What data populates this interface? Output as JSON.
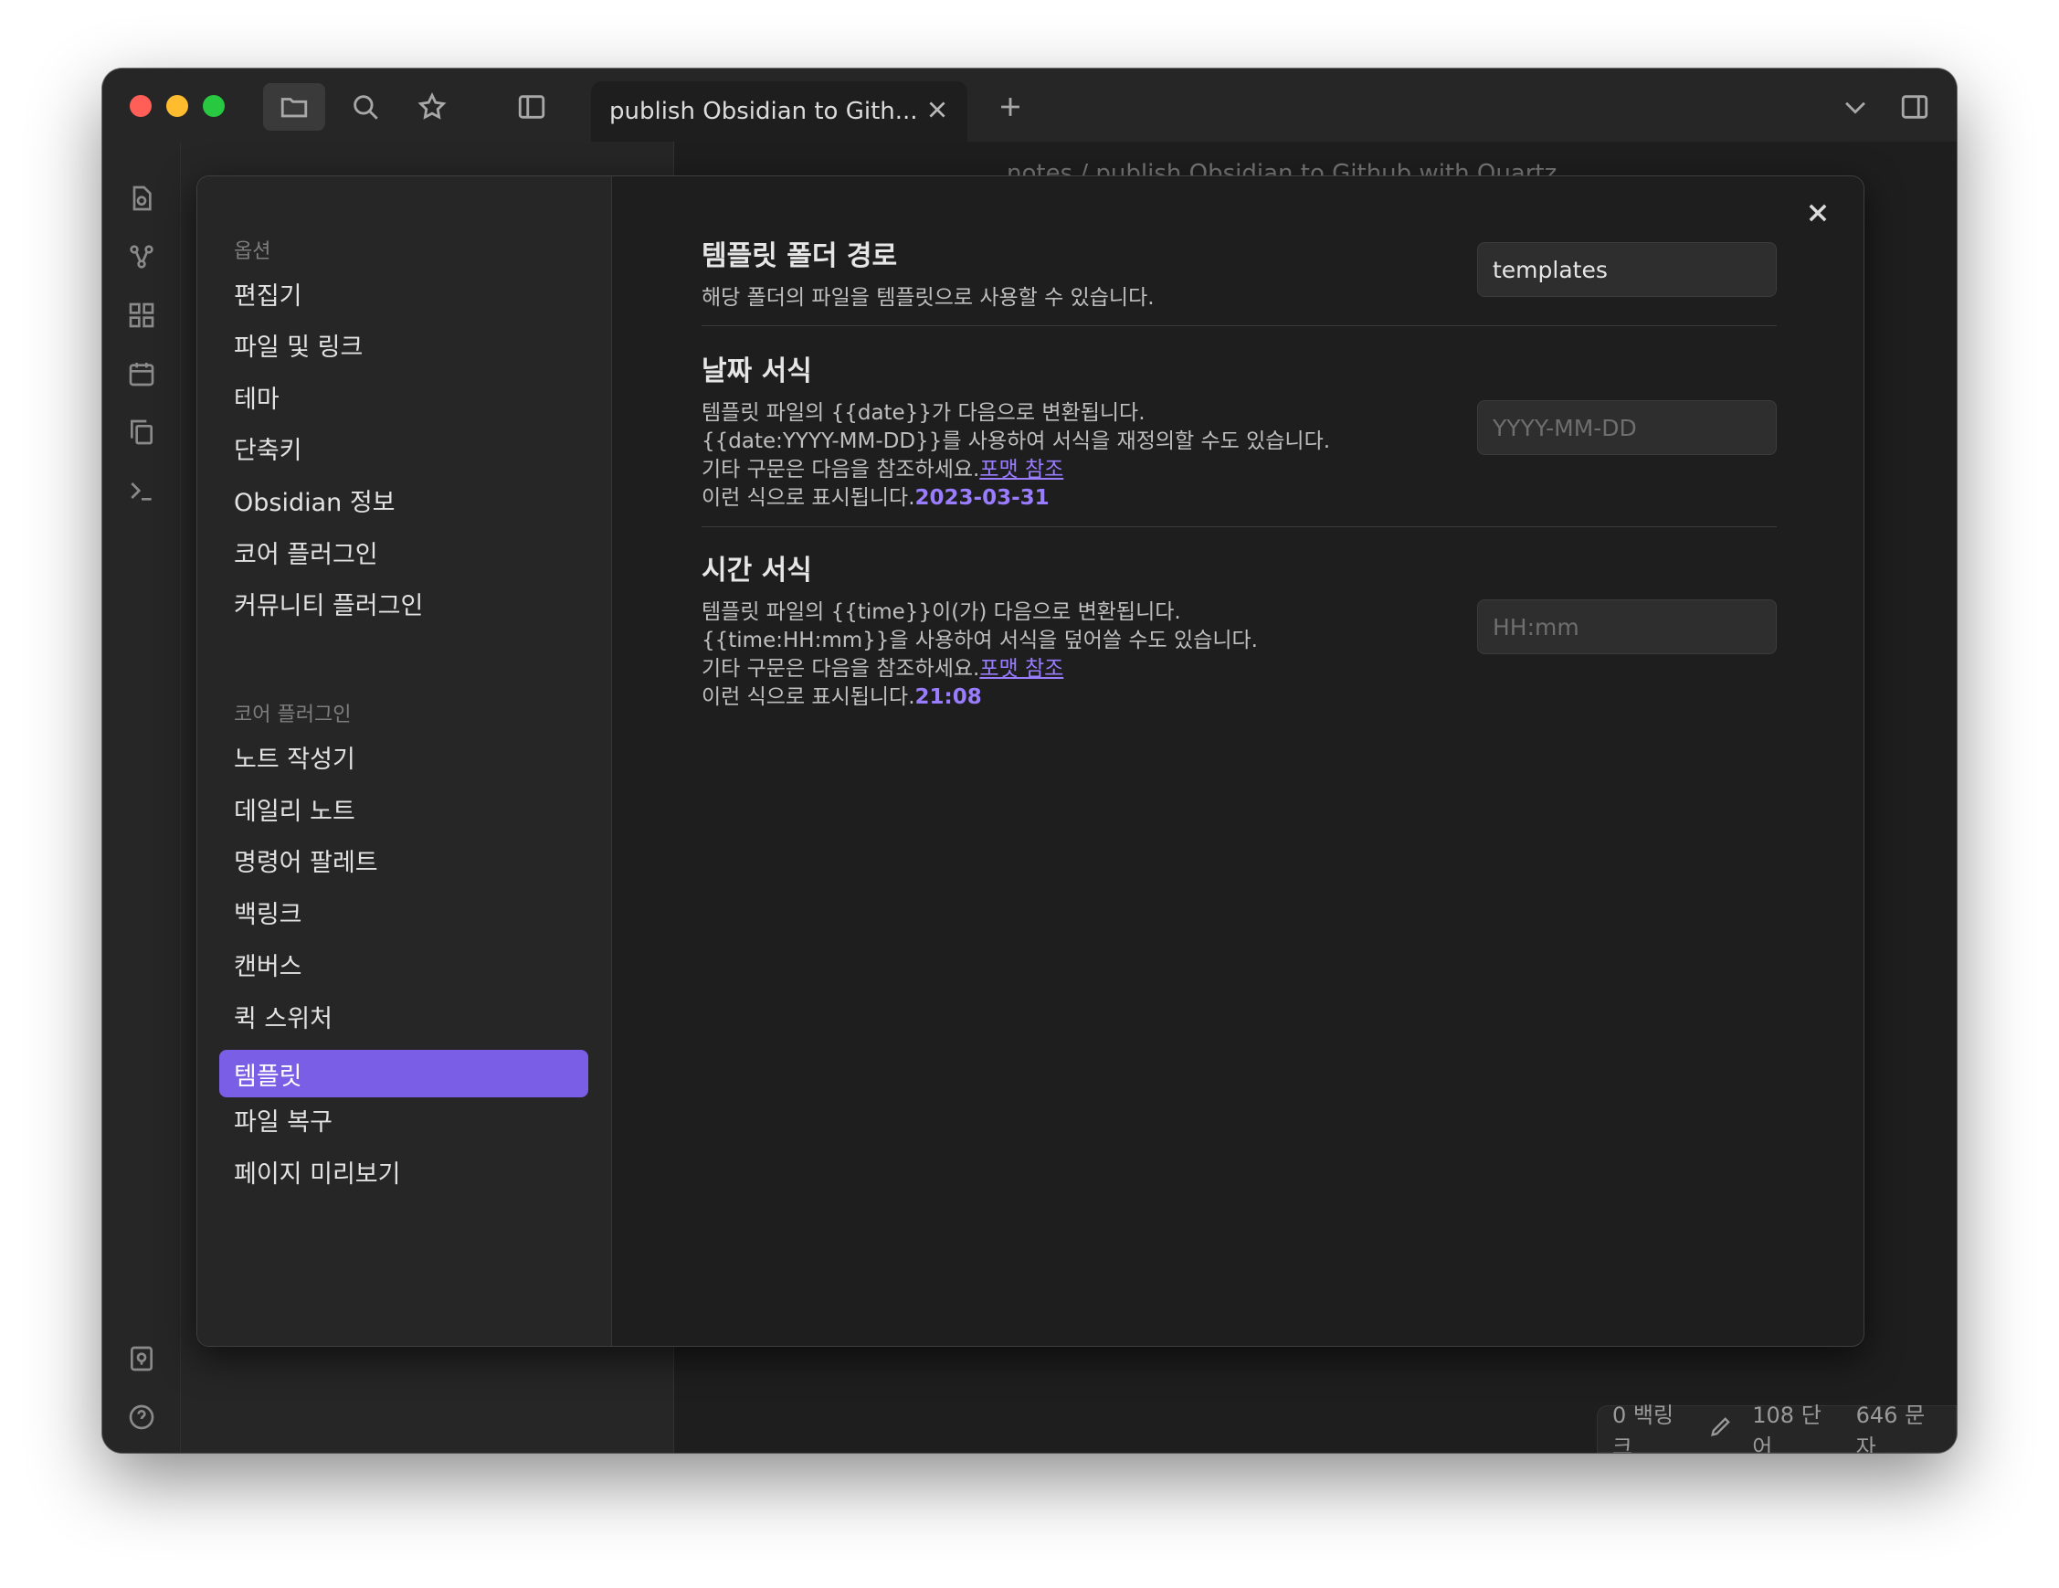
{
  "tab": {
    "title": "publish Obsidian to Gith..."
  },
  "background": {
    "header_path": "notes / publish Obsidian to Github with Quartz"
  },
  "statusbar": {
    "backlinks": "0 백링크",
    "words": "108 단어",
    "chars": "646 문자"
  },
  "settings_sidebar": {
    "options_heading": "옵션",
    "options": [
      "편집기",
      "파일 및 링크",
      "테마",
      "단축키",
      "Obsidian 정보",
      "코어 플러그인",
      "커뮤니티 플러그인"
    ],
    "core_heading": "코어 플러그인",
    "core_plugins": [
      "노트 작성기",
      "데일리 노트",
      "명령어 팔레트",
      "백링크",
      "캔버스",
      "퀵 스위처",
      "템플릿",
      "파일 복구",
      "페이지 미리보기"
    ],
    "active": "템플릿"
  },
  "settings": {
    "folder": {
      "name": "템플릿 폴더 경로",
      "desc": "해당 폴더의 파일을 템플릿으로 사용할 수 있습니다.",
      "value": "templates"
    },
    "date": {
      "name": "날짜 서식",
      "line1": "템플릿 파일의 {{date}}가 다음으로 변환됩니다.",
      "line2": "{{date:YYYY-MM-DD}}를 사용하여 서식을 재정의할 수도 있습니다.",
      "line3": "기타 구문은 다음을 참조하세요.",
      "link": "포맷 참조",
      "line4": "이런 식으로 표시됩니다.",
      "preview": "2023-03-31",
      "placeholder": "YYYY-MM-DD"
    },
    "time": {
      "name": "시간 서식",
      "line1": "템플릿 파일의 {{time}}이(가) 다음으로 변환됩니다.",
      "line2": "{{time:HH:mm}}을 사용하여 서식을 덮어쓸 수도 있습니다.",
      "line3": "기타 구문은 다음을 참조하세요.",
      "link": "포맷 참조",
      "line4": "이런 식으로 표시됩니다.",
      "preview": "21:08",
      "placeholder": "HH:mm"
    }
  },
  "colors": {
    "accent": "#7b5ee6",
    "link": "#9a7dff"
  }
}
